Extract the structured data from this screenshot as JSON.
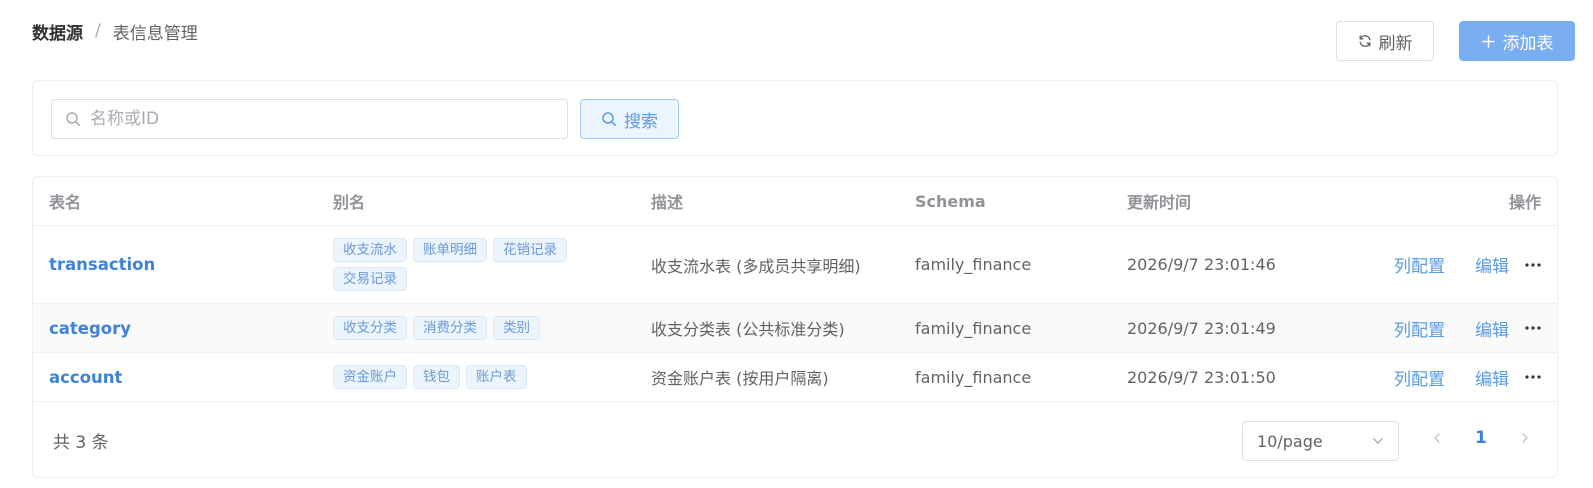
{
  "breadcrumb": {
    "root": "数据源",
    "separator": "/",
    "current": "表信息管理"
  },
  "toolbar": {
    "refresh_label": "刷新",
    "add_label": "添加表"
  },
  "search": {
    "placeholder": "名称或ID",
    "value": "",
    "button_label": "搜索"
  },
  "table": {
    "columns": {
      "name": "表名",
      "alias": "别名",
      "desc": "描述",
      "schema": "Schema",
      "updated": "更新时间",
      "actions": "操作"
    },
    "rows": [
      {
        "name": "transaction",
        "aliases": [
          "收支流水",
          "账单明细",
          "花销记录",
          "交易记录"
        ],
        "desc": "收支流水表 (多成员共享明细)",
        "schema": "family_finance",
        "updated": "2026/9/7 23:01:46",
        "action_columns": "列配置",
        "action_edit": "编辑"
      },
      {
        "name": "category",
        "aliases": [
          "收支分类",
          "消费分类",
          "类别"
        ],
        "desc": "收支分类表 (公共标准分类)",
        "schema": "family_finance",
        "updated": "2026/9/7 23:01:49",
        "action_columns": "列配置",
        "action_edit": "编辑"
      },
      {
        "name": "account",
        "aliases": [
          "资金账户",
          "钱包",
          "账户表"
        ],
        "desc": "资金账户表 (按用户隔离)",
        "schema": "family_finance",
        "updated": "2026/9/7 23:01:50",
        "action_columns": "列配置",
        "action_edit": "编辑"
      }
    ]
  },
  "pagination": {
    "total_text": "共 3 条",
    "page_size": "10/page",
    "current_page": "1"
  },
  "icons": {
    "refresh": "refresh-icon",
    "add": "plus-icon",
    "search": "search-icon",
    "more": "more-icon",
    "chevron": "chevron-icon"
  },
  "colors": {
    "primary": "#79aef0",
    "link": "#3f82d9",
    "tag_bg": "#ecf4fd"
  }
}
